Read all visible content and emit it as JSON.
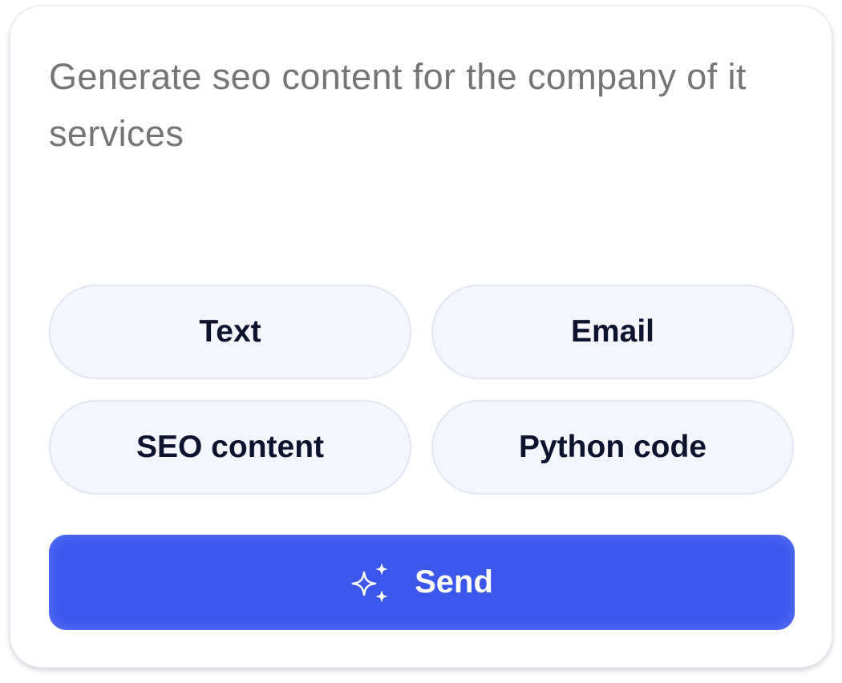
{
  "prompt": {
    "placeholder": "Generate seo content for the company of it services"
  },
  "options": [
    {
      "label": "Text"
    },
    {
      "label": "Email"
    },
    {
      "label": "SEO content"
    },
    {
      "label": "Python code"
    }
  ],
  "send_button": {
    "label": "Send",
    "icon": "sparkles-icon"
  },
  "colors": {
    "accent": "#3b57ec",
    "chip_background": "#f5f6fc",
    "chip_border": "#e3e7f3",
    "label_text": "#0e1430",
    "placeholder_text": "#9b9eab"
  }
}
